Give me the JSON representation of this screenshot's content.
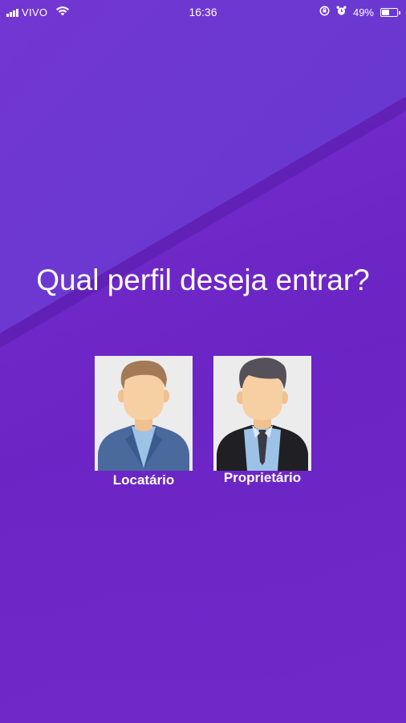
{
  "status_bar": {
    "carrier": "VIVO",
    "time": "16:36",
    "battery_percent": "49%",
    "battery_level": 0.49,
    "icons": [
      "signal-icon",
      "wifi-icon",
      "orientation-lock-icon",
      "alarm-icon",
      "battery-icon"
    ]
  },
  "page": {
    "question": "Qual perfil deseja entrar?"
  },
  "profiles": [
    {
      "label": "Locatário",
      "icon": "tenant-avatar-icon"
    },
    {
      "label": "Proprietário",
      "icon": "owner-avatar-icon"
    }
  ],
  "colors": {
    "background_top": "#7336d2",
    "background_bottom": "#6a24c4",
    "avatar_bg": "#ececec",
    "text": "#ffffff"
  }
}
